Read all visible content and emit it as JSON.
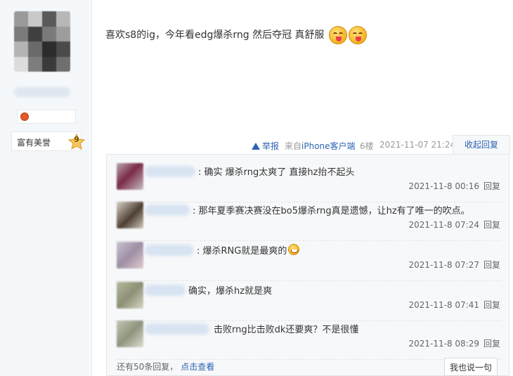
{
  "user": {
    "badge_label": "富有美誉",
    "badge_level": "9"
  },
  "post": {
    "text": "喜欢s8的ig，今年看edg爆杀rng 然后夺冠 真舒服",
    "emojis": [
      "tongue-face-icon",
      "tongue-face-icon"
    ]
  },
  "meta": {
    "report": "举报",
    "source_prefix": "来自",
    "source_link": "iPhone客户端",
    "floor": "6楼",
    "time": "2021-11-07 21:24",
    "collapse": "收起回复"
  },
  "replies": [
    {
      "text": ": 确实 爆杀rng太爽了 直接hz抬不起头",
      "time": "2021-11-8 00:16",
      "reply": "回复"
    },
    {
      "text": ": 那年夏季赛决赛没在bo5爆杀rng真是遗憾，让hz有了唯一的吹点。",
      "time": "2021-11-8 07:24",
      "reply": "回复"
    },
    {
      "text": ": 爆杀RNG就是最爽的",
      "time": "2021-11-8 07:27",
      "reply": "回复"
    },
    {
      "text": "确实，爆杀hz就是爽",
      "time": "2021-11-8 07:41",
      "reply": "回复"
    },
    {
      "text": "击败rng比击败dk还要爽？不是很懂",
      "time": "2021-11-8 08:29",
      "reply": "回复"
    }
  ],
  "footer": {
    "more_text": "还有50条回复，",
    "more_link": "点击查看",
    "say_button": "我也说一句"
  },
  "colors": {
    "link": "#2d64b3",
    "reply_bg": "#f7f8fa",
    "sidebar_bg": "#f5f8fb"
  }
}
